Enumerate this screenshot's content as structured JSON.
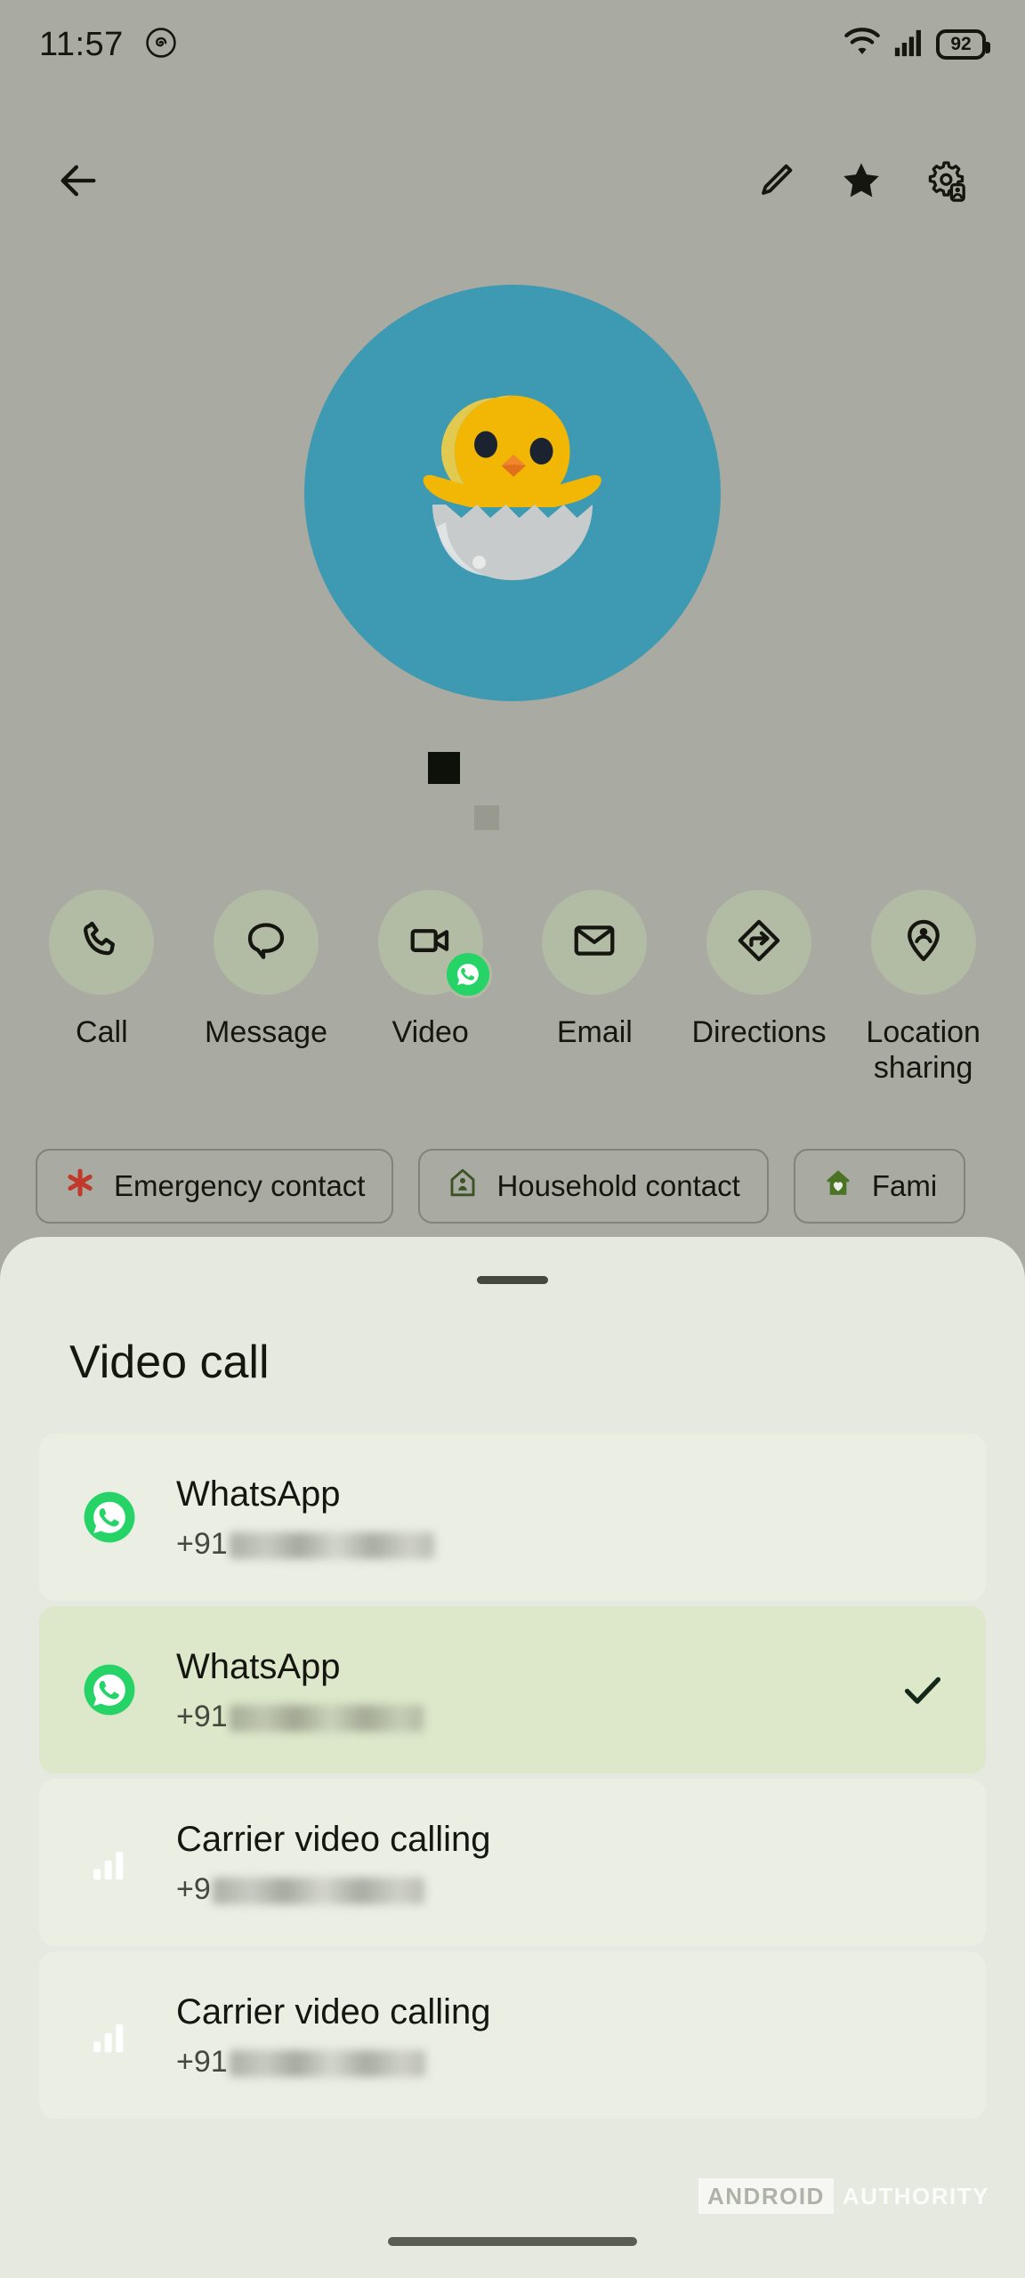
{
  "status_bar": {
    "time": "11:57",
    "notification_icon": "threads-icon",
    "wifi_icon": "wifi-icon",
    "signal_icon": "cellular-signal-icon",
    "battery_level": "92"
  },
  "app_bar": {
    "back_icon": "back-arrow-icon",
    "edit_icon": "pencil-edit-icon",
    "favorite_icon": "star-filled-icon",
    "settings_icon": "contact-settings-icon"
  },
  "contact": {
    "avatar_icon": "hatching-chick-emoji-avatar",
    "avatar_background": "#3E9AB2",
    "name_redacted": true
  },
  "quick_actions": [
    {
      "label": "Call",
      "icon": "phone-icon",
      "badge": null
    },
    {
      "label": "Message",
      "icon": "chat-bubble-icon",
      "badge": null
    },
    {
      "label": "Video",
      "icon": "video-camera-icon",
      "badge": "whatsapp-badge-icon"
    },
    {
      "label": "Email",
      "icon": "envelope-icon",
      "badge": null
    },
    {
      "label": "Directions",
      "icon": "directions-diamond-icon",
      "badge": null
    },
    {
      "label": "Location sharing",
      "icon": "location-pin-person-icon",
      "badge": null
    }
  ],
  "chips": [
    {
      "label": "Emergency contact",
      "icon": "star-of-life-icon",
      "icon_color": "#C0392B"
    },
    {
      "label": "Household contact",
      "icon": "household-house-icon",
      "icon_color": "#3C5227"
    },
    {
      "label": "Fami",
      "icon": "family-house-heart-icon",
      "icon_color": "#4A7323"
    }
  ],
  "sheet": {
    "title": "Video call",
    "handle": "drag-handle",
    "options": [
      {
        "title": "WhatsApp",
        "number_prefix": "+91",
        "number_redacted": true,
        "icon": "whatsapp-icon",
        "selected": false
      },
      {
        "title": "WhatsApp",
        "number_prefix": "+91",
        "number_redacted": true,
        "icon": "whatsapp-icon",
        "selected": true
      },
      {
        "title": "Carrier video calling",
        "number_prefix": "+9",
        "number_redacted": true,
        "icon": "signal-bars-icon",
        "selected": false
      },
      {
        "title": "Carrier video calling",
        "number_prefix": "+91",
        "number_redacted": true,
        "icon": "signal-bars-icon",
        "selected": false
      }
    ],
    "check_icon": "checkmark-icon"
  },
  "watermark": {
    "part1": "ANDROID",
    "part2": "AUTHORITY"
  },
  "nav_bar": {
    "gesture_pill": "home-gesture-pill"
  },
  "colors": {
    "background": "#A9AAA1",
    "sheet_background": "#E6E9DF",
    "row_background": "#EBEEE3",
    "row_selected_background": "#DCE8C9",
    "whatsapp_green": "#25D366",
    "accent_dark": "#14160F"
  }
}
